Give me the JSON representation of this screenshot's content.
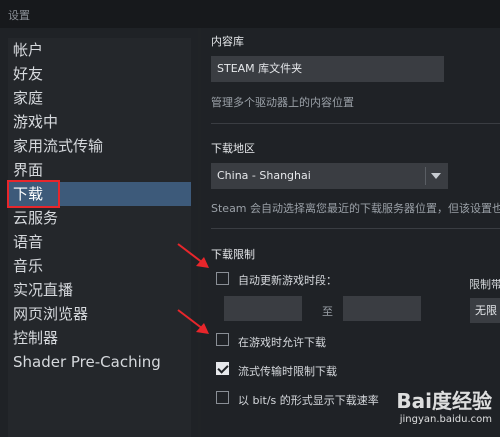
{
  "window": {
    "title": "设置"
  },
  "sidebar": {
    "items": [
      {
        "label": "帐户"
      },
      {
        "label": "好友"
      },
      {
        "label": "家庭"
      },
      {
        "label": "游戏中"
      },
      {
        "label": "家用流式传输"
      },
      {
        "label": "界面"
      },
      {
        "label": "下载",
        "active": true
      },
      {
        "label": "云服务"
      },
      {
        "label": "语音"
      },
      {
        "label": "音乐"
      },
      {
        "label": "实况直播"
      },
      {
        "label": "网页浏览器"
      },
      {
        "label": "控制器"
      },
      {
        "label": "Shader Pre-Caching"
      }
    ]
  },
  "content": {
    "library": {
      "title": "内容库",
      "folder_button": "STEAM 库文件夹",
      "description": "管理多个驱动器上的内容位置"
    },
    "region": {
      "title": "下载地区",
      "selected": "China - Shanghai",
      "description": "Steam 会自动选择离您最近的下载服务器位置，但该设置也"
    },
    "limits": {
      "title": "下载限制",
      "auto_update_label": "自动更新游戏时段：",
      "auto_update_checked": false,
      "time_separator": "至",
      "bandwidth_label": "限制带",
      "bandwidth_value": "无限",
      "allow_ingame_label": "在游戏时允许下载",
      "allow_ingame_checked": false,
      "throttle_stream_label": "流式传输时限制下载",
      "throttle_stream_checked": true,
      "show_bits_label": "以 bit/s 的形式显示下载速率",
      "show_bits_checked": false
    }
  },
  "watermark": {
    "logo": "Bai度经验",
    "url": "jingyan.baidu.com"
  },
  "colors": {
    "accent_active": "#3d5a7a",
    "highlight_box": "#e8262b",
    "arrow": "#e8262b"
  }
}
